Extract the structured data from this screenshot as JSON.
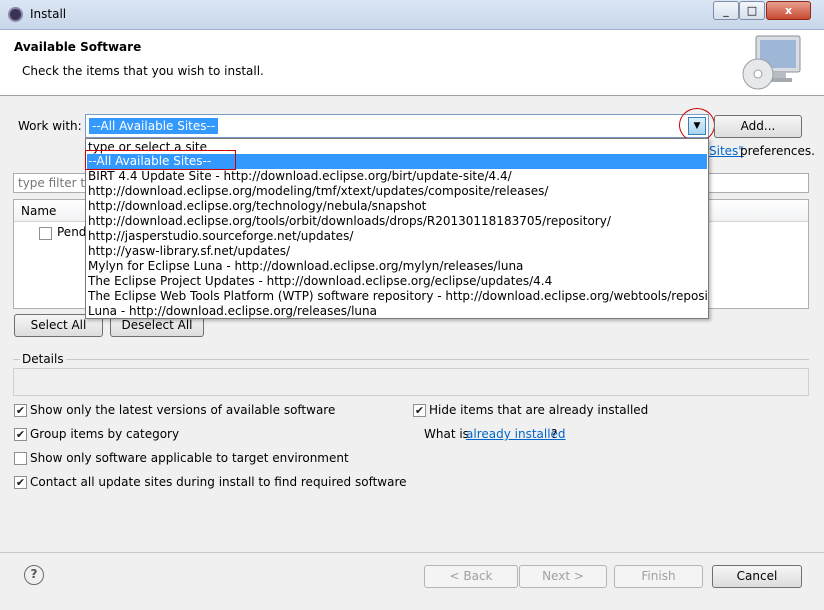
{
  "window": {
    "title": "Install",
    "controls": {
      "minimize": "_",
      "maximize": "□",
      "close": "x"
    }
  },
  "header": {
    "title": "Available Software",
    "description": "Check the items that you wish to install."
  },
  "work_with": {
    "label": "Work with:",
    "selected_value": "--All Available Sites--",
    "add_button": "Add..."
  },
  "available_sites_hint": {
    "link": "Sites\"",
    "suffix": "preferences."
  },
  "filter": {
    "placeholder": "type filter tex"
  },
  "table": {
    "columns": [
      "Name"
    ],
    "rows": [
      {
        "label": "Pend"
      }
    ]
  },
  "dropdown": {
    "typed_hint": "type or select a site",
    "items": [
      "--All Available Sites--",
      "BIRT 4.4 Update Site - http://download.eclipse.org/birt/update-site/4.4/",
      "http://download.eclipse.org/modeling/tmf/xtext/updates/composite/releases/",
      "http://download.eclipse.org/technology/nebula/snapshot",
      "http://download.eclipse.org/tools/orbit/downloads/drops/R20130118183705/repository/",
      "http://jasperstudio.sourceforge.net/updates/",
      "http://yasw-library.sf.net/updates/",
      "Mylyn for Eclipse Luna - http://download.eclipse.org/mylyn/releases/luna",
      "The Eclipse Project Updates - http://download.eclipse.org/eclipse/updates/4.4",
      "The Eclipse Web Tools Platform (WTP) software repository - http://download.eclipse.org/webtools/repository/luna",
      "Luna - http://download.eclipse.org/releases/luna"
    ],
    "selected_index": 0
  },
  "selection_buttons": {
    "select_all": "Select All",
    "deselect_all": "Deselect All"
  },
  "details": {
    "label": "Details"
  },
  "options": {
    "latest_versions": {
      "label": "Show only the latest versions of available software",
      "checked": true
    },
    "group_by_category": {
      "label": "Group items by category",
      "checked": true
    },
    "target_environment": {
      "label": "Show only software applicable to target environment",
      "checked": false
    },
    "contact_all_sites": {
      "label": "Contact all update sites during install to find required software",
      "checked": true
    },
    "hide_installed": {
      "label": "Hide items that are already installed",
      "checked": true
    },
    "what_is_prefix": "What is",
    "already_installed_link": "already installed",
    "what_is_suffix": "?"
  },
  "footer": {
    "help": "?",
    "back": "< Back",
    "next": "Next >",
    "finish": "Finish",
    "cancel": "Cancel"
  }
}
